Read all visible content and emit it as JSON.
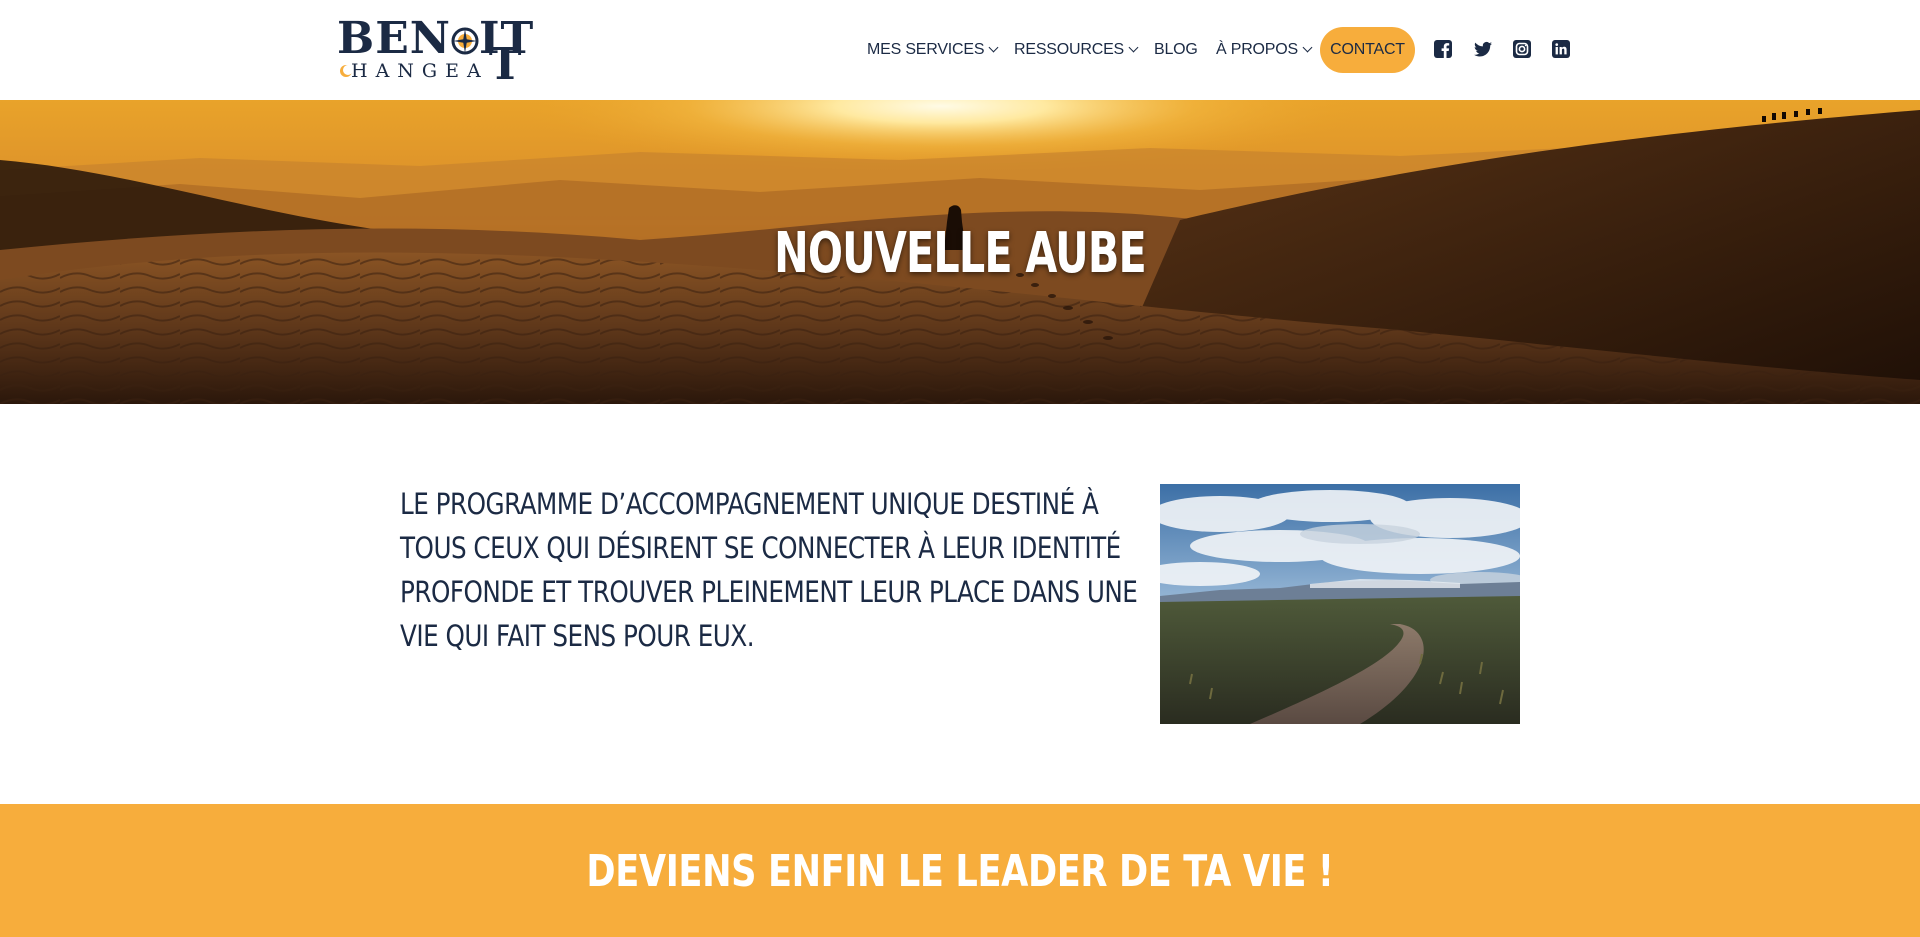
{
  "logo": {
    "top_text": "BENOIT",
    "bottom_text": "CHANGEAT"
  },
  "nav": {
    "items": [
      {
        "label": "MES SERVICES",
        "dropdown": true
      },
      {
        "label": "RESSOURCES",
        "dropdown": true
      },
      {
        "label": "BLOG",
        "dropdown": false
      },
      {
        "label": "À PROPOS",
        "dropdown": true
      }
    ],
    "contact_label": "CONTACT",
    "social_icons": [
      "facebook-icon",
      "twitter-icon",
      "instagram-icon",
      "linkedin-icon"
    ]
  },
  "hero": {
    "title": "NOUVELLE AUBE"
  },
  "intro": {
    "text": "LE PROGRAMME D’ACCOMPAGNEMENT UNIQUE DESTINÉ À TOUS CEUX QUI DÉSIRENT SE CONNECTER À LEUR IDENTITÉ PROFONDE ET TROUVER PLEINEMENT LEUR PLACE DANS UNE VIE QUI FAIT SENS POUR EUX."
  },
  "banner": {
    "title": "DEVIENS ENFIN LE LEADER DE TA VIE !"
  },
  "colors": {
    "accent": "#f7ad3c",
    "navy": "#1b2a44",
    "white": "#ffffff"
  }
}
